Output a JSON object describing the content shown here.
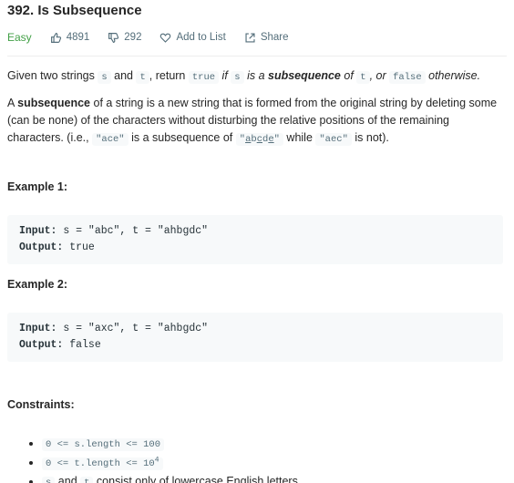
{
  "problem": {
    "title": "392. Is Subsequence",
    "difficulty": "Easy",
    "likes": "4891",
    "dislikes": "292",
    "add_to_list": "Add to List",
    "share": "Share",
    "colors": {
      "difficulty": "#43a047",
      "meta": "#546e7a",
      "code_bg": "#f7f9fa"
    },
    "icons": {
      "likes": "thumbs-up-icon",
      "dislikes": "thumbs-down-icon",
      "add_to_list": "heart-icon",
      "share": "share-icon"
    }
  },
  "description": {
    "p1": {
      "t1": "Given two strings ",
      "c1": "s",
      "t2": " and ",
      "c2": "t",
      "t3": ", return ",
      "c3": "true",
      "t4": " if ",
      "c4": "s",
      "t5": " is a ",
      "b1": "subsequence",
      "t6": " of ",
      "c5": "t",
      "t7": ", or ",
      "c6": "false",
      "t8": " otherwise."
    },
    "p2": {
      "b1": "subsequence",
      "t0": "A ",
      "t1": " of a string is a new string that is formed from the original string by deleting some (can be none) of the characters without disturbing the relative positions of the remaining characters. (i.e., ",
      "c1": "\"ace\"",
      "t2": " is a subsequence of ",
      "c2_open": "\"",
      "c2_a": "a",
      "c2_b": "b",
      "c2_c": "c",
      "c2_d": "d",
      "c2_e": "e",
      "c2_close": "\"",
      "t3": " while ",
      "c3": "\"aec\"",
      "t4": " is not)."
    }
  },
  "examples": [
    {
      "heading": "Example 1:",
      "input_label": "Input:",
      "input_value": " s = \"abc\", t = \"ahbgdc\"",
      "output_label": "Output:",
      "output_value": " true"
    },
    {
      "heading": "Example 2:",
      "input_label": "Input:",
      "input_value": " s = \"axc\", t = \"ahbgdc\"",
      "output_label": "Output:",
      "output_value": " false"
    }
  ],
  "constraints": {
    "heading": "Constraints:",
    "items": [
      {
        "code": "0 <= s.length <= 100"
      },
      {
        "code": "0 <= t.length <= 10",
        "sup": "4"
      },
      {
        "c1": "s",
        "t1": " and ",
        "c2": "t",
        "t2": " consist only of lowercase English letters."
      }
    ]
  }
}
